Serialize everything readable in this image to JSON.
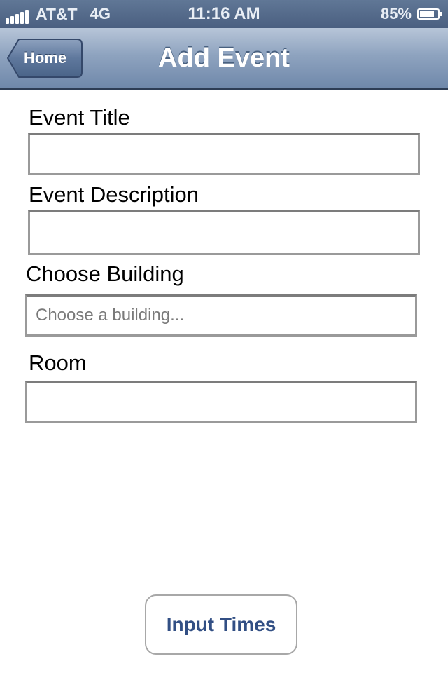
{
  "status_bar": {
    "carrier": "AT&T",
    "network": "4G",
    "time": "11:16 AM",
    "battery_percent": "85%",
    "battery_level": 0.85,
    "signal_bars": 5
  },
  "nav": {
    "title": "Add Event",
    "back_label": "Home"
  },
  "form": {
    "event_title": {
      "label": "Event Title",
      "value": "",
      "placeholder": ""
    },
    "event_description": {
      "label": "Event Description",
      "value": "",
      "placeholder": ""
    },
    "building": {
      "label": "Choose Building",
      "value": "",
      "placeholder": "Choose a building..."
    },
    "room": {
      "label": "Room",
      "value": "",
      "placeholder": ""
    }
  },
  "actions": {
    "input_times_label": "Input Times"
  },
  "colors": {
    "nav_gradient_top": "#b7c5d8",
    "nav_gradient_bottom": "#6f88aa",
    "status_bar": "#4a5f80",
    "button_text": "#324f84"
  },
  "icons": {
    "signal": "signal-bars-icon",
    "battery": "battery-icon",
    "back": "chevron-left-icon"
  }
}
